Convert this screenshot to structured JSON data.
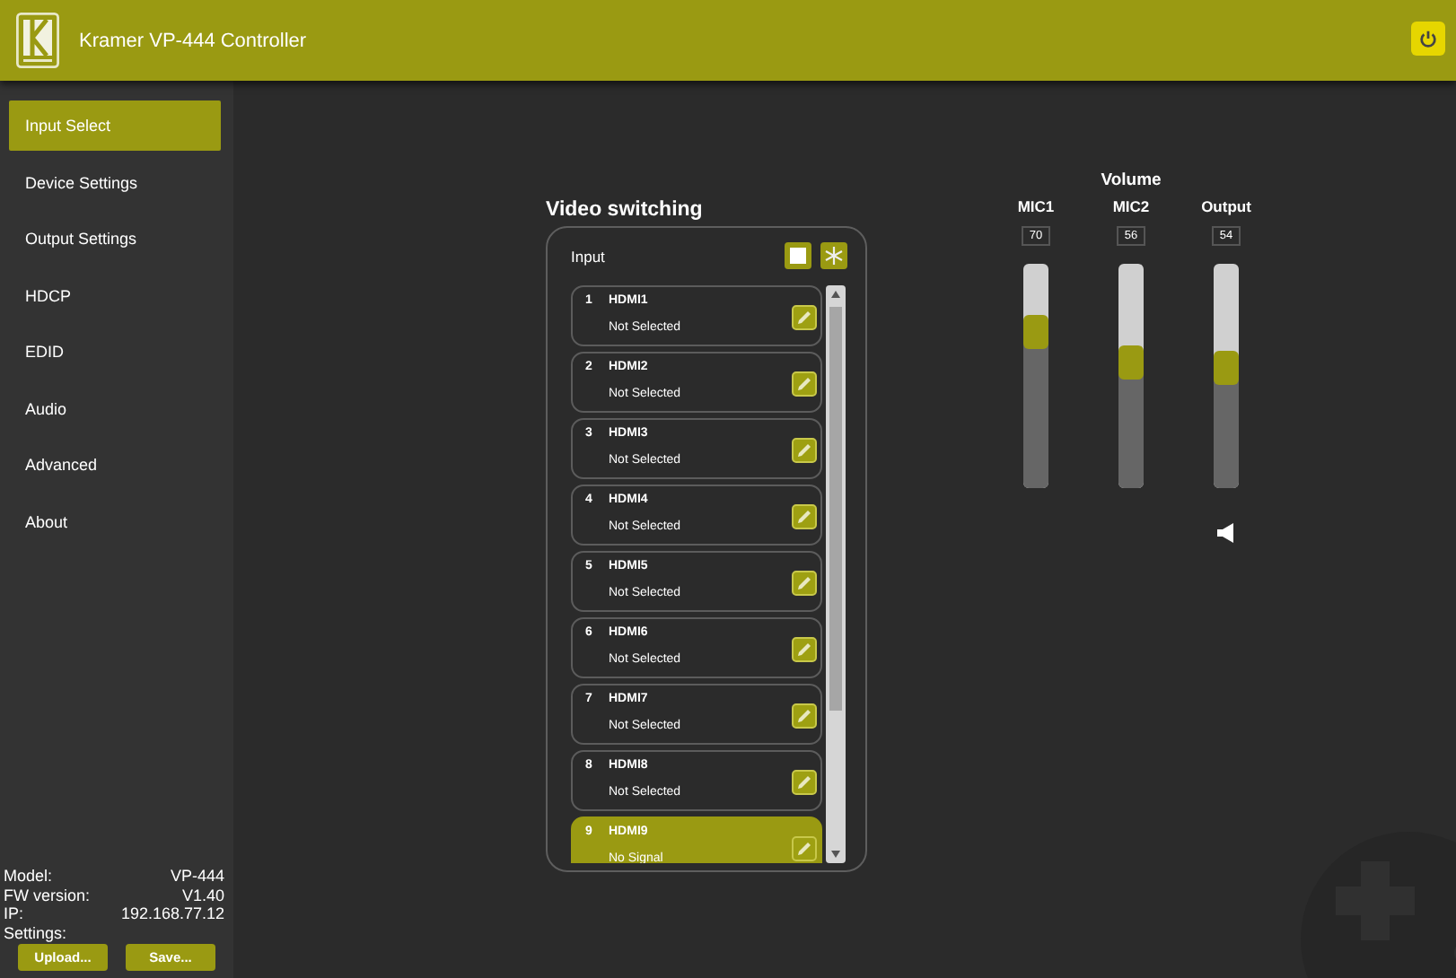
{
  "header": {
    "title": "Kramer VP-444 Controller"
  },
  "sidebar": {
    "items": [
      {
        "label": "Input Select",
        "selected": true
      },
      {
        "label": "Device Settings",
        "selected": false
      },
      {
        "label": "Output Settings",
        "selected": false
      },
      {
        "label": "HDCP",
        "selected": false
      },
      {
        "label": "EDID",
        "selected": false
      },
      {
        "label": "Audio",
        "selected": false
      },
      {
        "label": "Advanced",
        "selected": false
      },
      {
        "label": "About",
        "selected": false
      }
    ],
    "info": [
      {
        "label": "Model:",
        "value": "VP-444"
      },
      {
        "label": "FW version:",
        "value": "V1.40"
      },
      {
        "label": "IP:",
        "value": "192.168.77.12"
      }
    ],
    "settings_label": "Settings:",
    "buttons": [
      "Upload...",
      "Save..."
    ]
  },
  "video_switching": {
    "title": "Video switching",
    "input_label": "Input",
    "inputs": [
      {
        "number": "1",
        "name": "HDMI1",
        "status": "Not Selected",
        "selected": false
      },
      {
        "number": "2",
        "name": "HDMI2",
        "status": "Not Selected",
        "selected": false
      },
      {
        "number": "3",
        "name": "HDMI3",
        "status": "Not Selected",
        "selected": false
      },
      {
        "number": "4",
        "name": "HDMI4",
        "status": "Not Selected",
        "selected": false
      },
      {
        "number": "5",
        "name": "HDMI5",
        "status": "Not Selected",
        "selected": false
      },
      {
        "number": "6",
        "name": "HDMI6",
        "status": "Not Selected",
        "selected": false
      },
      {
        "number": "7",
        "name": "HDMI7",
        "status": "Not Selected",
        "selected": false
      },
      {
        "number": "8",
        "name": "HDMI8",
        "status": "Not Selected",
        "selected": false
      },
      {
        "number": "9",
        "name": "HDMI9",
        "status": "No Signal",
        "selected": true
      }
    ]
  },
  "volume": {
    "title": "Volume",
    "channels": [
      {
        "name": "MIC1",
        "value": "70",
        "level": 0.7
      },
      {
        "name": "MIC2",
        "value": "56",
        "level": 0.56
      },
      {
        "name": "Output",
        "value": "54",
        "level": 0.54
      }
    ]
  }
}
